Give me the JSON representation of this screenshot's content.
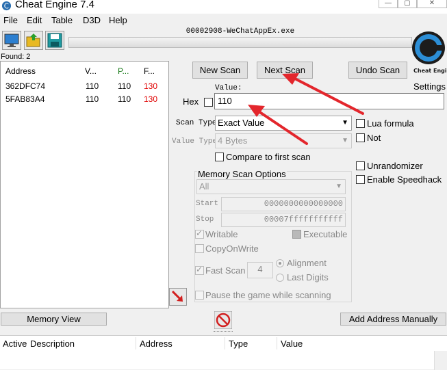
{
  "window": {
    "title": "Cheat Engine 7.4",
    "min": "—",
    "max": "▢",
    "close": "✕"
  },
  "menu": [
    "File",
    "Edit",
    "Table",
    "D3D",
    "Help"
  ],
  "process": {
    "name": "00002908-WeChatAppEx.exe"
  },
  "found": "Found: 2",
  "results": {
    "columns": [
      "Address",
      "V...",
      "P...",
      "F..."
    ],
    "rows": [
      {
        "address": "362DFC74",
        "value": "110",
        "previous": "110",
        "first": "130"
      },
      {
        "address": "5FAB83A4",
        "value": "110",
        "previous": "110",
        "first": "130"
      }
    ]
  },
  "buttons": {
    "new_scan": "New Scan",
    "next_scan": "Next Scan",
    "undo_scan": "Undo Scan",
    "memory_view": "Memory View",
    "add_address": "Add Address Manually"
  },
  "settings": {
    "label": "Settings",
    "logo_text": "Cheat Engine"
  },
  "scan": {
    "value_label": "Value:",
    "hex_label": "Hex",
    "value": "110",
    "scan_type_label": "Scan Type",
    "scan_type": "Exact Value",
    "value_type_label": "Value Type",
    "value_type": "4 Bytes",
    "compare_first": "Compare to first scan"
  },
  "options_right": {
    "lua_formula": "Lua formula",
    "not": "Not",
    "unrandomizer": "Unrandomizer",
    "speedhack": "Enable Speedhack"
  },
  "memory_options": {
    "title": "Memory Scan Options",
    "region": "All",
    "start_label": "Start",
    "start": "0000000000000000",
    "stop_label": "Stop",
    "stop": "00007fffffffffff",
    "writable": "Writable",
    "executable": "Executable",
    "copy_on_write": "CopyOnWrite",
    "fast_scan": "Fast Scan",
    "fast_scan_value": "4",
    "alignment": "Alignment",
    "last_digits": "Last Digits",
    "pause": "Pause the game while scanning"
  },
  "address_list": {
    "columns": [
      "Active",
      "Description",
      "Address",
      "Type",
      "Value"
    ]
  },
  "colors": {
    "first_value": "#e00000",
    "previous_header": "#1a7a1a",
    "annotation_arrow": "#e3262c"
  }
}
